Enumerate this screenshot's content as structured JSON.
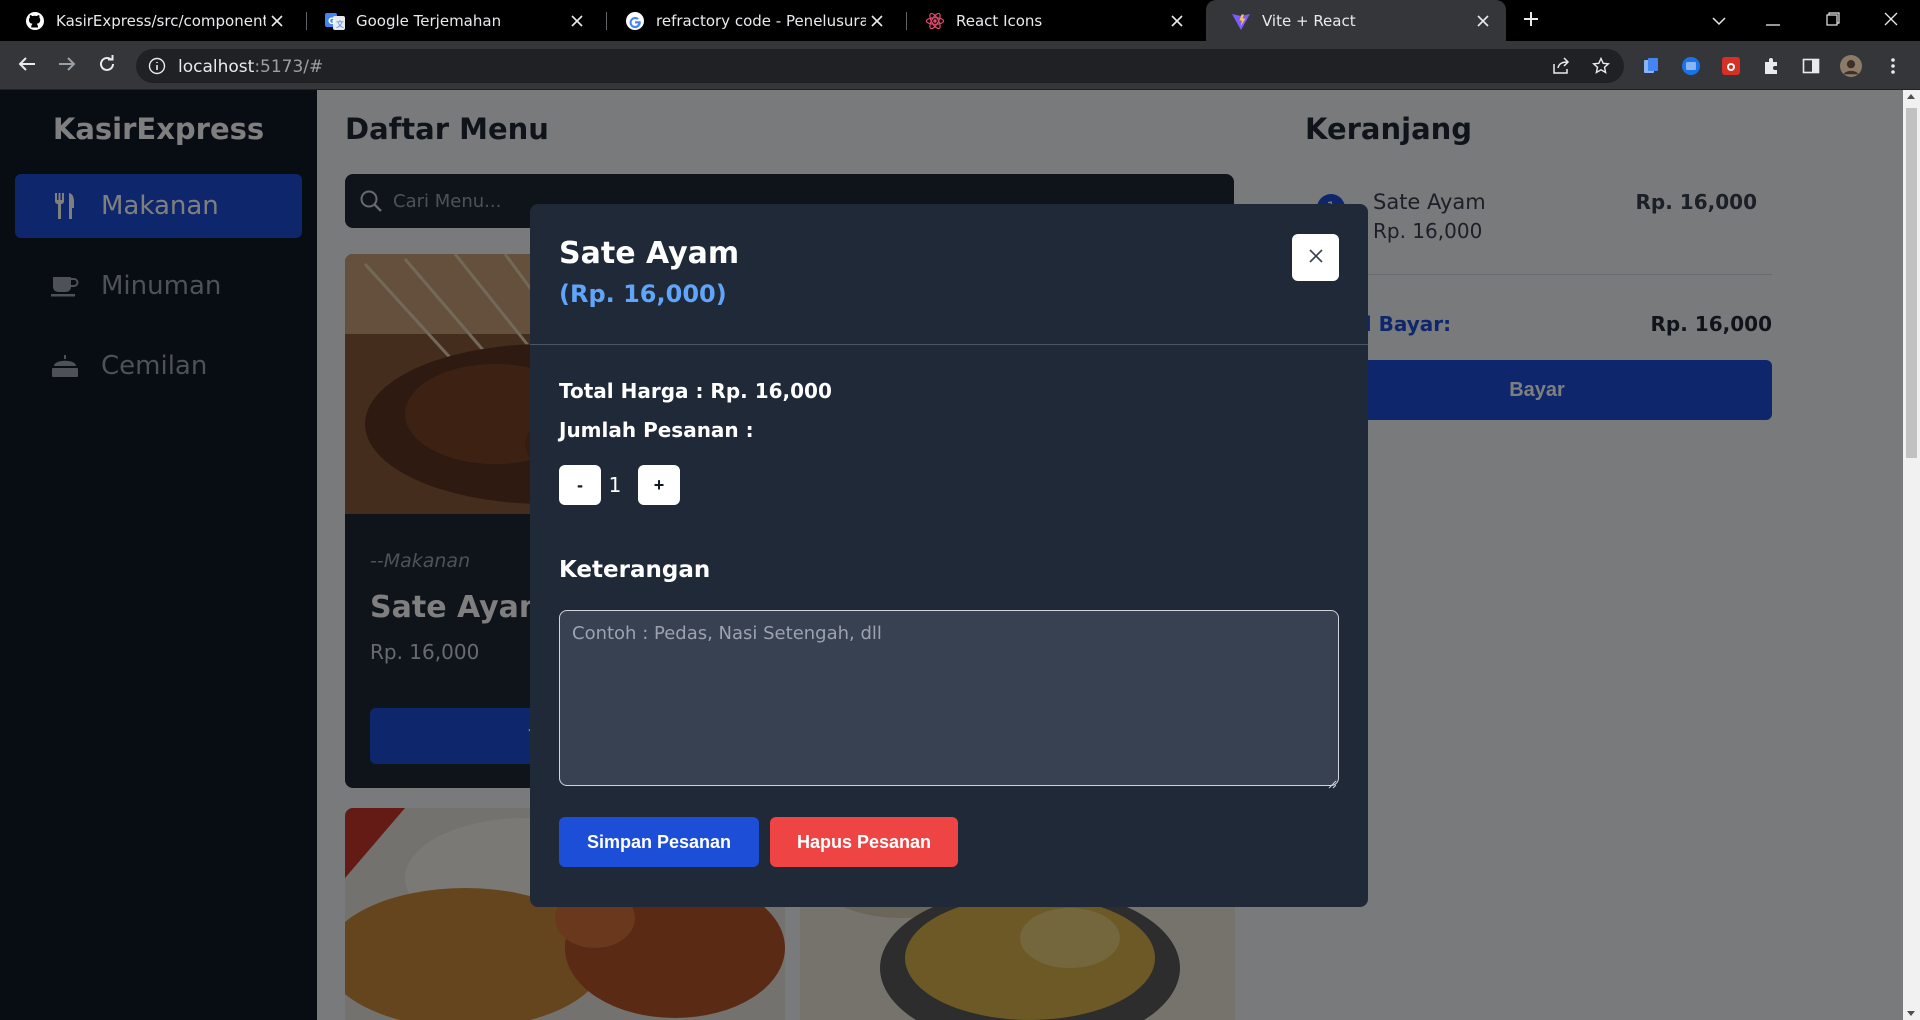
{
  "browser": {
    "tabs": [
      {
        "title": "KasirExpress/src/components/To",
        "icon": "github-icon"
      },
      {
        "title": "Google Terjemahan",
        "icon": "google-translate-icon"
      },
      {
        "title": "refractory code - Penelusuran Go",
        "icon": "google-icon"
      },
      {
        "title": "React Icons",
        "icon": "react-icon"
      },
      {
        "title": "Vite + React",
        "icon": "vite-icon"
      }
    ],
    "active_tab": 4,
    "url_host": "localhost",
    "url_path": ":5173/#"
  },
  "app": {
    "brand": "KasirExpress",
    "sidebar": {
      "items": [
        {
          "label": "Makanan",
          "icon": "utensils-icon",
          "active": true
        },
        {
          "label": "Minuman",
          "icon": "coffee-cup-icon",
          "active": false
        },
        {
          "label": "Cemilan",
          "icon": "snack-bowl-icon",
          "active": false
        }
      ]
    },
    "menu": {
      "title": "Daftar Menu",
      "search_placeholder": "Cari Menu...",
      "card": {
        "category": "--Makanan",
        "name": "Sate Ayam",
        "price": "Rp. 16,000",
        "button": "Tambah"
      }
    },
    "cart": {
      "title": "Keranjang",
      "items": [
        {
          "qty": "1",
          "name": "Sate Ayam",
          "unit_price": "Rp. 16,000",
          "subtotal": "Rp. 16,000"
        }
      ],
      "total_label": "Total Bayar:",
      "total_value": "Rp. 16,000",
      "pay_button": "Bayar"
    }
  },
  "modal": {
    "title": "Sate Ayam",
    "price": "(Rp. 16,000)",
    "total_price": "Total Harga : Rp. 16,000",
    "qty_label": "Jumlah Pesanan :",
    "minus": "-",
    "plus": "+",
    "qty_value": "1",
    "note_label": "Keterangan",
    "note_placeholder": "Contoh : Pedas, Nasi Setengah, dll",
    "save_button": "Simpan Pesanan",
    "delete_button": "Hapus Pesanan"
  },
  "colors": {
    "accent": "#1d4ed8",
    "danger": "#ef4444",
    "sidebar_bg": "#111827",
    "panel_bg": "#1f2937",
    "price_text": "#60a5fa"
  }
}
